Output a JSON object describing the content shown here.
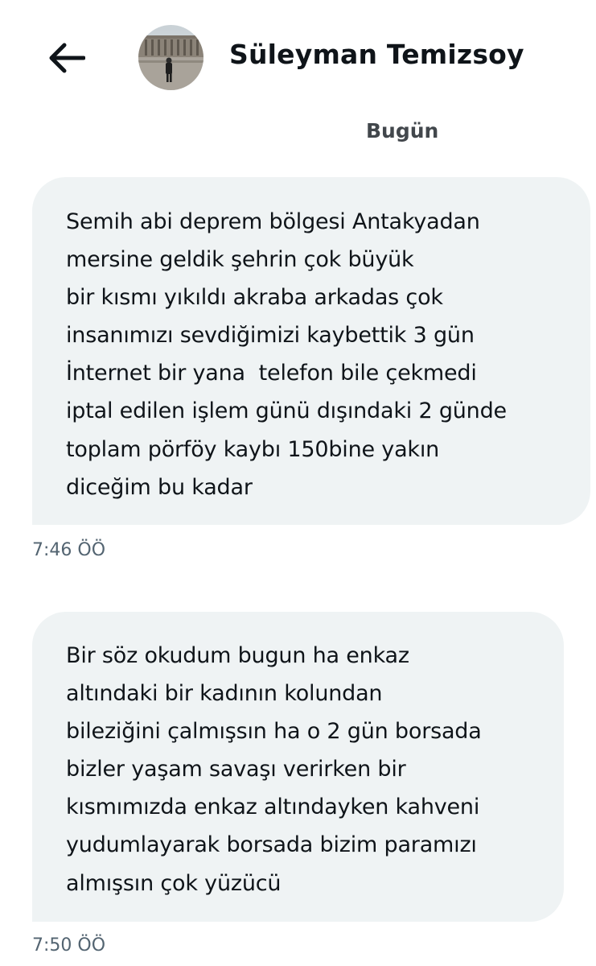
{
  "header": {
    "back_icon": "arrow-left-icon",
    "contact_name": "Süleyman Temizsoy",
    "avatar_icon": "profile-photo-avatar"
  },
  "conversation": {
    "date_separator": "Bugün",
    "messages": [
      {
        "lines": [
          "Semih abi deprem bölgesi Antakyadan",
          "mersine geldik şehrin çok büyük",
          "bir kısmı yıkıldı akraba arkadas çok",
          "insanımızı sevdiğimizi kaybettik 3 gün",
          "İnternet bir yana  telefon bile çekmedi",
          "iptal edilen işlem günü dışındaki 2 günde",
          "toplam pörföy kaybı 150bine yakın",
          "diceğim bu kadar"
        ],
        "time": "7:46 ÖÖ"
      },
      {
        "lines": [
          "Bir söz okudum bugun ha enkaz",
          "altındaki bir kadının kolundan",
          "bileziğini çalmışsın ha o 2 gün borsada",
          "bizler yaşam savaşı verirken bir",
          "kısmımızda enkaz altındayken kahveni",
          "yudumlayarak borsada bizim paramızı",
          "almışsın çok yüzücü"
        ],
        "time": "7:50 ÖÖ"
      }
    ]
  },
  "colors": {
    "bubble_bg": "#eff3f4",
    "text": "#0f1419",
    "muted": "#536471"
  }
}
